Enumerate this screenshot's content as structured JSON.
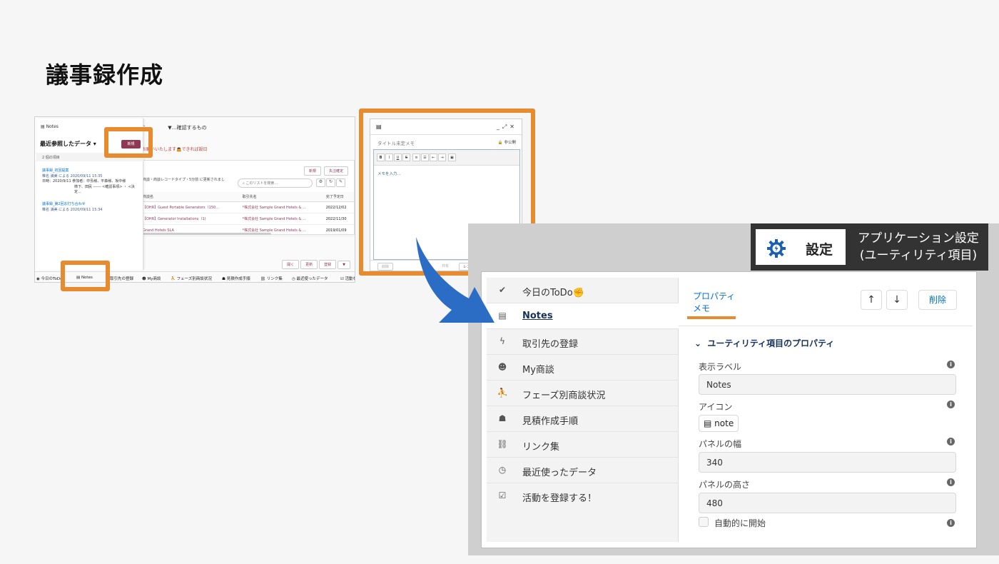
{
  "slide": {
    "title": "議事録作成"
  },
  "shot1": {
    "tabs": [
      "活動ら",
      "▼…確認するもの"
    ],
    "red_notice": "お願いいたします🙇できれば設日",
    "list_buttons": [
      "新規",
      "失注確定"
    ],
    "list_subtitle": "商談・商談レコードタイプ・5分前 に更新されまし",
    "search_placeholder": "このリストを検索...",
    "columns": [
      "商談名",
      "取引先名",
      "完了予定日"
    ],
    "rows": [
      [
        "【OHR】Guest Portable Generators（150...",
        "*株式会社 Sample Grand Hotels & ...",
        "2022/12/02"
      ],
      [
        "【OHR】Generator Installations（1)",
        "*株式会社 Sample Grand Hotels & ...",
        "2022/11/30"
      ],
      [
        "Grand Hotels SLA",
        "*株式会社 Sample Grand Hotels & ...",
        "2019/01/09"
      ]
    ],
    "footer_buttons": [
      "開く",
      "更新",
      "登録",
      "▼"
    ],
    "panel_header": "Notes",
    "recent_label": "最近参照したデータ ▾",
    "new_button": "新規",
    "count": "2 個の項目",
    "items": [
      {
        "title": "議事録_初回提案",
        "meta": "椎名 満美 による 2020/09/11 15:35",
        "body1": "日時：2020/9/11 参加者：中島様、平森様、坂中様",
        "body2": "柿下、田民 ------ <確認事項> ・ <決定..."
      },
      {
        "title": "議事録_第2回お打ち合わせ",
        "meta": "椎名 満美 による 2020/09/11 15:34"
      }
    ],
    "utility_bar": [
      "◉ 今日のToDo",
      "▤ Notes",
      "取引先の登録",
      "☻ My商談",
      "⛹ フェーズ別商談状況",
      "☗ 見積作成手順",
      "⛓ リンク集",
      "◷ 最近使ったデータ",
      "☑ 活動を登録する！"
    ]
  },
  "shot2": {
    "title_placeholder": "タイトル未定メモ",
    "privacy": "🔒 非公開",
    "toolbar": [
      "B",
      "I",
      "U",
      "S",
      "≡",
      "☰",
      "⇤",
      "⇥",
      "▣"
    ],
    "body_placeholder": "メモを入力...",
    "buttons": [
      "削除",
      "共有",
      "レコードに追加",
      "完了"
    ]
  },
  "settings_badge": {
    "word": "設定",
    "caption_line1": "アプリケーション設定",
    "caption_line2": "(ユーティリティ項目)"
  },
  "nav": [
    {
      "label": "今日のToDo✊",
      "icon": "check-circle-icon"
    },
    {
      "label": "Notes",
      "icon": "note-icon",
      "active": true
    },
    {
      "label": "取引先の登録",
      "icon": "lightning-icon"
    },
    {
      "label": "My商談",
      "icon": "smiley-icon"
    },
    {
      "label": "フェーズ別商談状況",
      "icon": "runner-icon"
    },
    {
      "label": "見積作成手順",
      "icon": "presentation-icon"
    },
    {
      "label": "リンク集",
      "icon": "link-icon"
    },
    {
      "label": "最近使ったデータ",
      "icon": "clock-icon"
    },
    {
      "label": "活動を登録する！",
      "icon": "clipboard-icon"
    }
  ],
  "properties": {
    "tab_line1": "プロパティ",
    "tab_line2": "メモ",
    "delete_label": "削除",
    "section_title": "ユーティリティ項目のプロパティ",
    "display_label_label": "表示ラベル",
    "display_label_value": "Notes",
    "icon_label": "アイコン",
    "icon_value": "note",
    "width_label": "パネルの幅",
    "width_value": "340",
    "height_label": "パネルの高さ",
    "height_value": "480",
    "autostart_label": "自動的に開始"
  },
  "colors": {
    "highlight": "#e88b2e",
    "arrow": "#2b6cc4",
    "brand": "#8e3a55",
    "link": "#0070d2"
  }
}
